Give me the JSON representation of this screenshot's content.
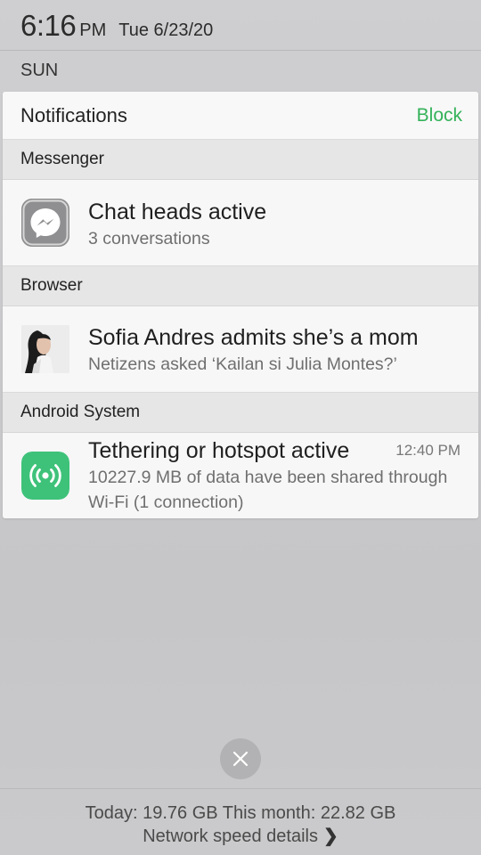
{
  "status_bar": {
    "time": "6:16",
    "ampm": "PM",
    "date": "Tue 6/23/20",
    "day": "SUN"
  },
  "panel": {
    "title": "Notifications",
    "block_label": "Block",
    "sections": [
      {
        "app": "Messenger",
        "title": "Chat heads active",
        "text": "3 conversations",
        "icon": "messenger-icon"
      },
      {
        "app": "Browser",
        "title": "Sofia Andres admits she’s a mom",
        "text": "Netizens asked ‘Kailan si Julia Montes?’",
        "icon": "news-thumbnail"
      },
      {
        "app": "Android System",
        "title": "Tethering or hotspot active",
        "time": "12:40 PM",
        "text": "10227.9 MB of data have been shared through Wi-Fi (1 connection)",
        "icon": "hotspot-icon"
      }
    ]
  },
  "footer": {
    "usage": "Today: 19.76 GB This month: 22.82 GB",
    "speed_label": "Network speed details"
  },
  "colors": {
    "accent_green": "#33b25a",
    "hotspot_green": "#3ec27a"
  }
}
